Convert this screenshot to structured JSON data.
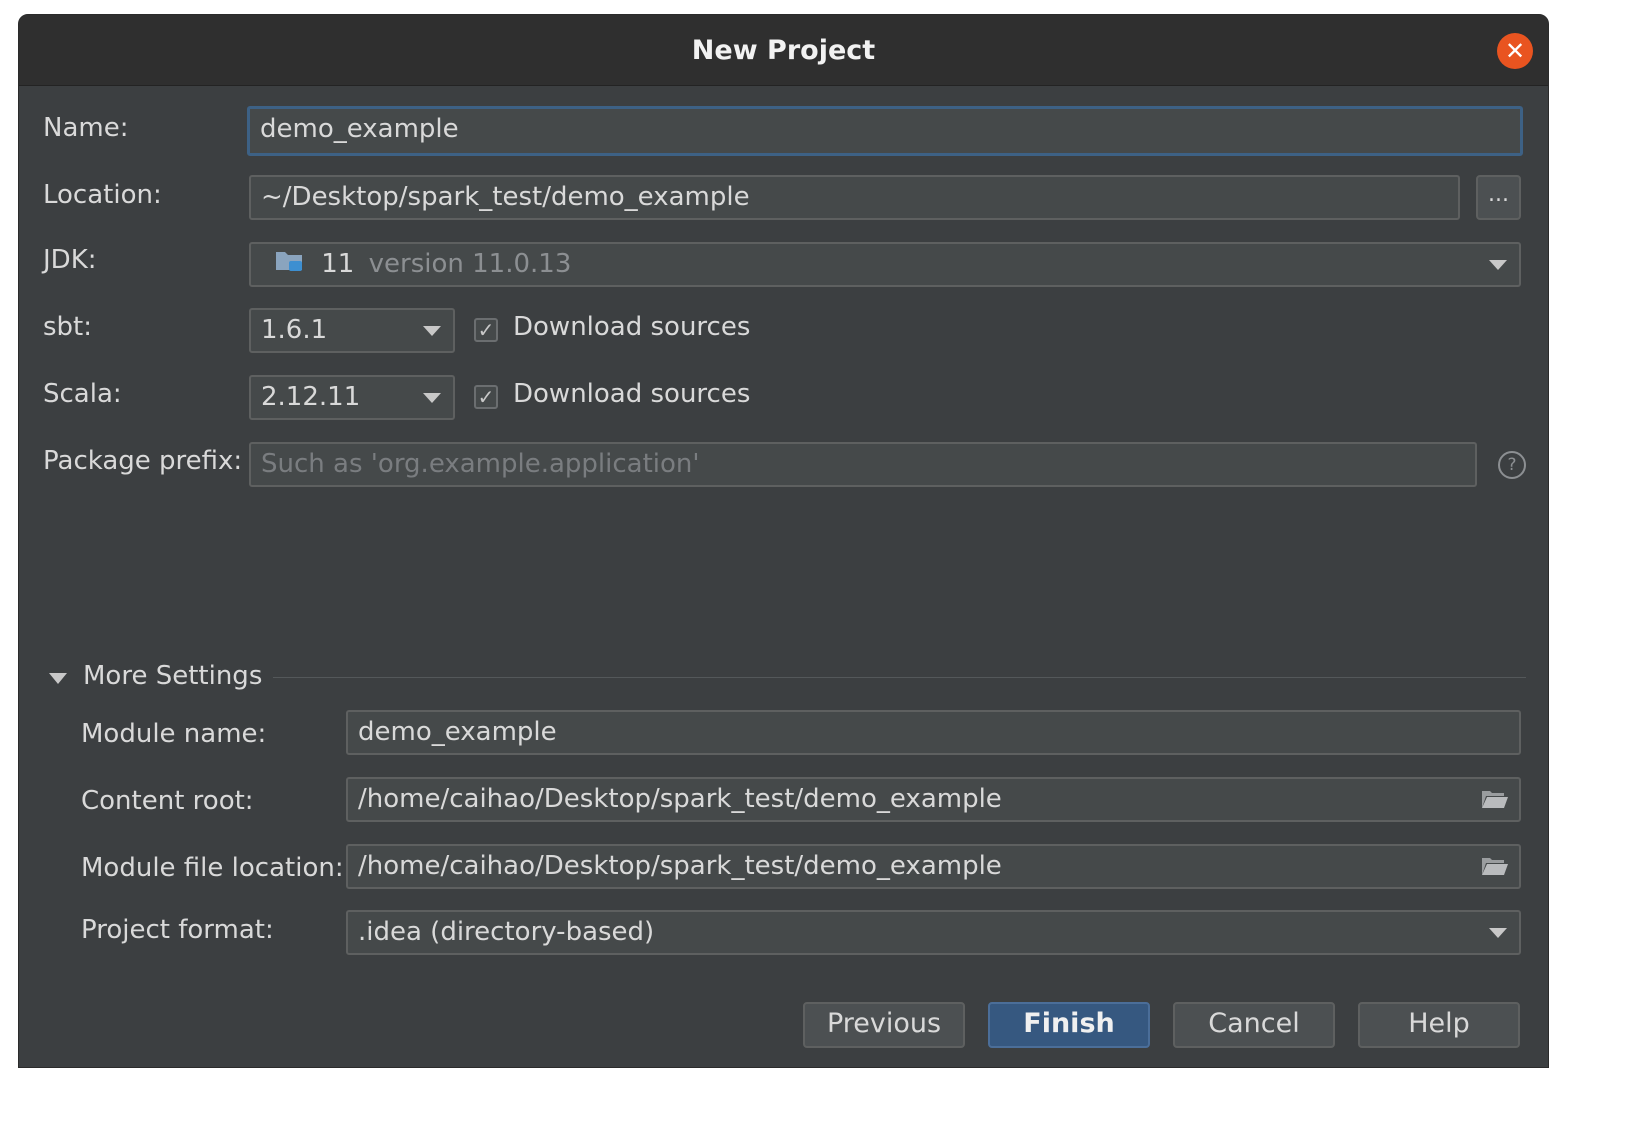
{
  "window": {
    "title": "New Project",
    "close_icon": "close-icon"
  },
  "form": {
    "name_label": "Name:",
    "name_value": "demo_example",
    "location_label": "Location:",
    "location_value": "~/Desktop/spark_test/demo_example",
    "browse_label": "...",
    "jdk_label": "JDK:",
    "jdk_number": "11",
    "jdk_version": "version 11.0.13",
    "sbt_label": "sbt:",
    "sbt_value": "1.6.1",
    "sbt_download_label": "Download sources",
    "sbt_download_checked": true,
    "scala_label": "Scala:",
    "scala_value": "2.12.11",
    "scala_download_label": "Download sources",
    "scala_download_checked": true,
    "package_label": "Package prefix:",
    "package_placeholder": "Such as 'org.example.application'",
    "help_icon": "question-icon"
  },
  "more_settings": {
    "title": "More Settings",
    "module_name_label": "Module name:",
    "module_name_value": "demo_example",
    "content_root_label": "Content root:",
    "content_root_value": "/home/caihao/Desktop/spark_test/demo_example",
    "module_file_label": "Module file location:",
    "module_file_value": "/home/caihao/Desktop/spark_test/demo_example",
    "project_format_label": "Project format:",
    "project_format_value": ".idea (directory-based)"
  },
  "buttons": {
    "previous": "Previous",
    "finish": "Finish",
    "cancel": "Cancel",
    "help": "Help"
  },
  "colors": {
    "dialog_bg": "#3c3f41",
    "field_bg": "#45494a",
    "accent": "#365880",
    "close_button": "#e95420"
  }
}
